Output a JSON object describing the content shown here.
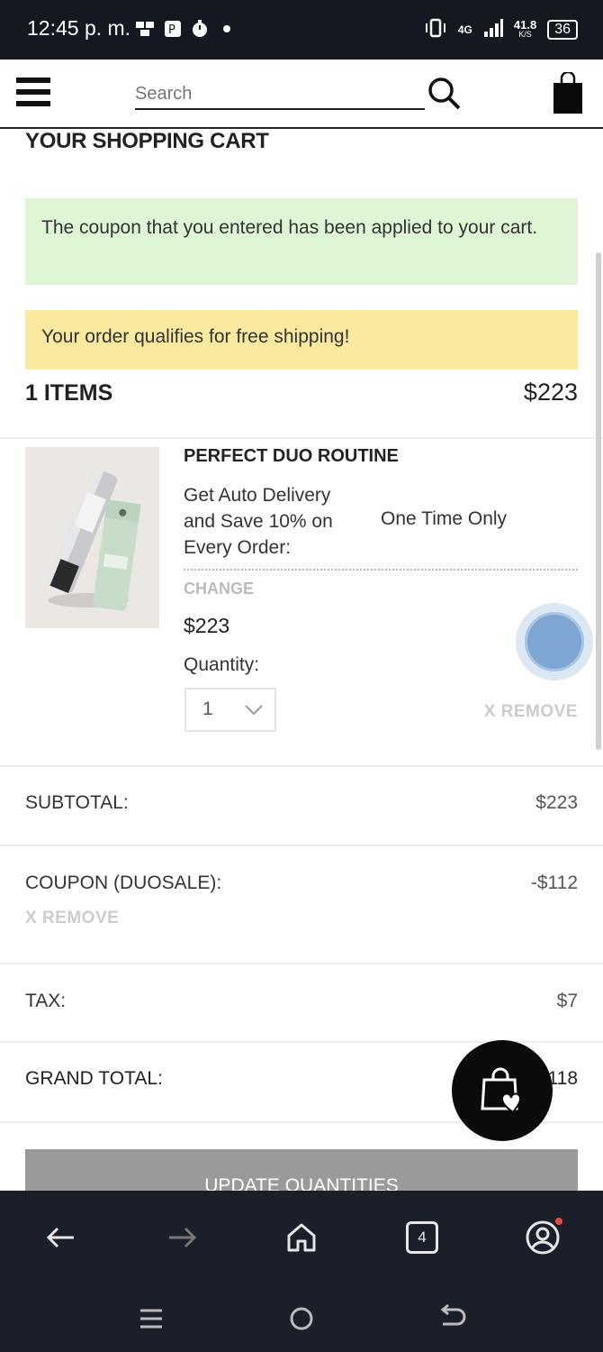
{
  "status_bar": {
    "time": "12:45 p. m.",
    "network": "4G",
    "speed": "41.8",
    "speed_unit": "K/S",
    "battery": "36"
  },
  "header": {
    "search_placeholder": "Search",
    "menu_icon": "hamburger-menu-icon",
    "search_icon": "search-icon",
    "bag_icon": "shopping-bag-icon"
  },
  "cart": {
    "title": "YOUR SHOPPING CART",
    "coupon_message": "The coupon that you entered has been applied to your cart.",
    "shipping_message": "Your order qualifies for free shipping!",
    "items_count_label": "1 ITEMS",
    "items_total": "$223",
    "product": {
      "name": "PERFECT DUO ROUTINE",
      "auto_delivery_option": "Get Auto Delivery and Save 10% on Every Order:",
      "one_time_option": "One Time Only",
      "change_label": "CHANGE",
      "price": "$223",
      "quantity_label": "Quantity:",
      "quantity_value": "1",
      "remove_label": "X REMOVE"
    }
  },
  "summary": {
    "subtotal_label": "SUBTOTAL:",
    "subtotal_value": "$223",
    "coupon_label": "COUPON (DUOSALE):",
    "coupon_value": "-$112",
    "coupon_remove_label": "X REMOVE",
    "tax_label": "TAX:",
    "tax_value": "$7",
    "grand_total_label": "GRAND TOTAL:",
    "grand_total_value": "118",
    "update_button": "UPDATE QUANTITIES"
  },
  "browser_nav": {
    "tabs_count": "4"
  },
  "colors": {
    "success_bg": "#dff6d6",
    "shipping_bg": "#fbea9d",
    "nav_bg": "#1b1f2a",
    "button_bg": "#9a9a9a",
    "muted_link": "#cccccc"
  }
}
